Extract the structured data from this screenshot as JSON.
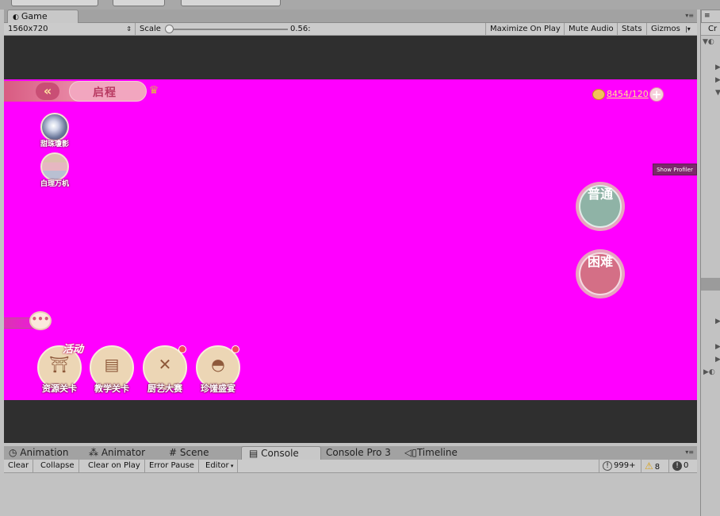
{
  "game_panel": {
    "tab_label": "Game",
    "resolution": "1560x720",
    "scale_label": "Scale",
    "scale_value": "0.56:",
    "toolbar_buttons": [
      "Maximize On Play",
      "Mute Audio",
      "Stats",
      "Gizmos"
    ]
  },
  "game_ui": {
    "title": "启程",
    "currency_text": "8454/120",
    "side_icons": [
      {
        "label": "甜珠瓊影",
        "icon": "orb-icon"
      },
      {
        "label": "白理万机",
        "icon": "bands-icon"
      }
    ],
    "show_profiler": "Show Profiler",
    "difficulty": [
      {
        "label": "普通",
        "color": "#8fb3a6"
      },
      {
        "label": "困难",
        "color": "#d46f86"
      }
    ],
    "chat_icon": "•••",
    "activity_tag": "活动",
    "bottom_buttons": [
      {
        "label": "资源关卡",
        "icon": "temple-icon",
        "red_dot": false
      },
      {
        "label": "教学关卡",
        "icon": "book-icon",
        "red_dot": false
      },
      {
        "label": "厨艺大赛",
        "icon": "utensils-icon",
        "red_dot": true
      },
      {
        "label": "珍馐盛宴",
        "icon": "cloche-icon",
        "red_dot": true
      }
    ],
    "magenta": "#ff00ff"
  },
  "right_panel": {
    "tab_label": "Cr"
  },
  "console_panel": {
    "tabs": [
      "Animation",
      "Animator",
      "Scene",
      "Console",
      "Console Pro 3",
      "Timeline"
    ],
    "active_tab": "Console",
    "toolbar_buttons": [
      "Clear",
      "Collapse",
      "Clear on Play",
      "Error Pause",
      "Editor"
    ],
    "info_count": "999+",
    "warning_count": "8",
    "error_count": "0"
  }
}
